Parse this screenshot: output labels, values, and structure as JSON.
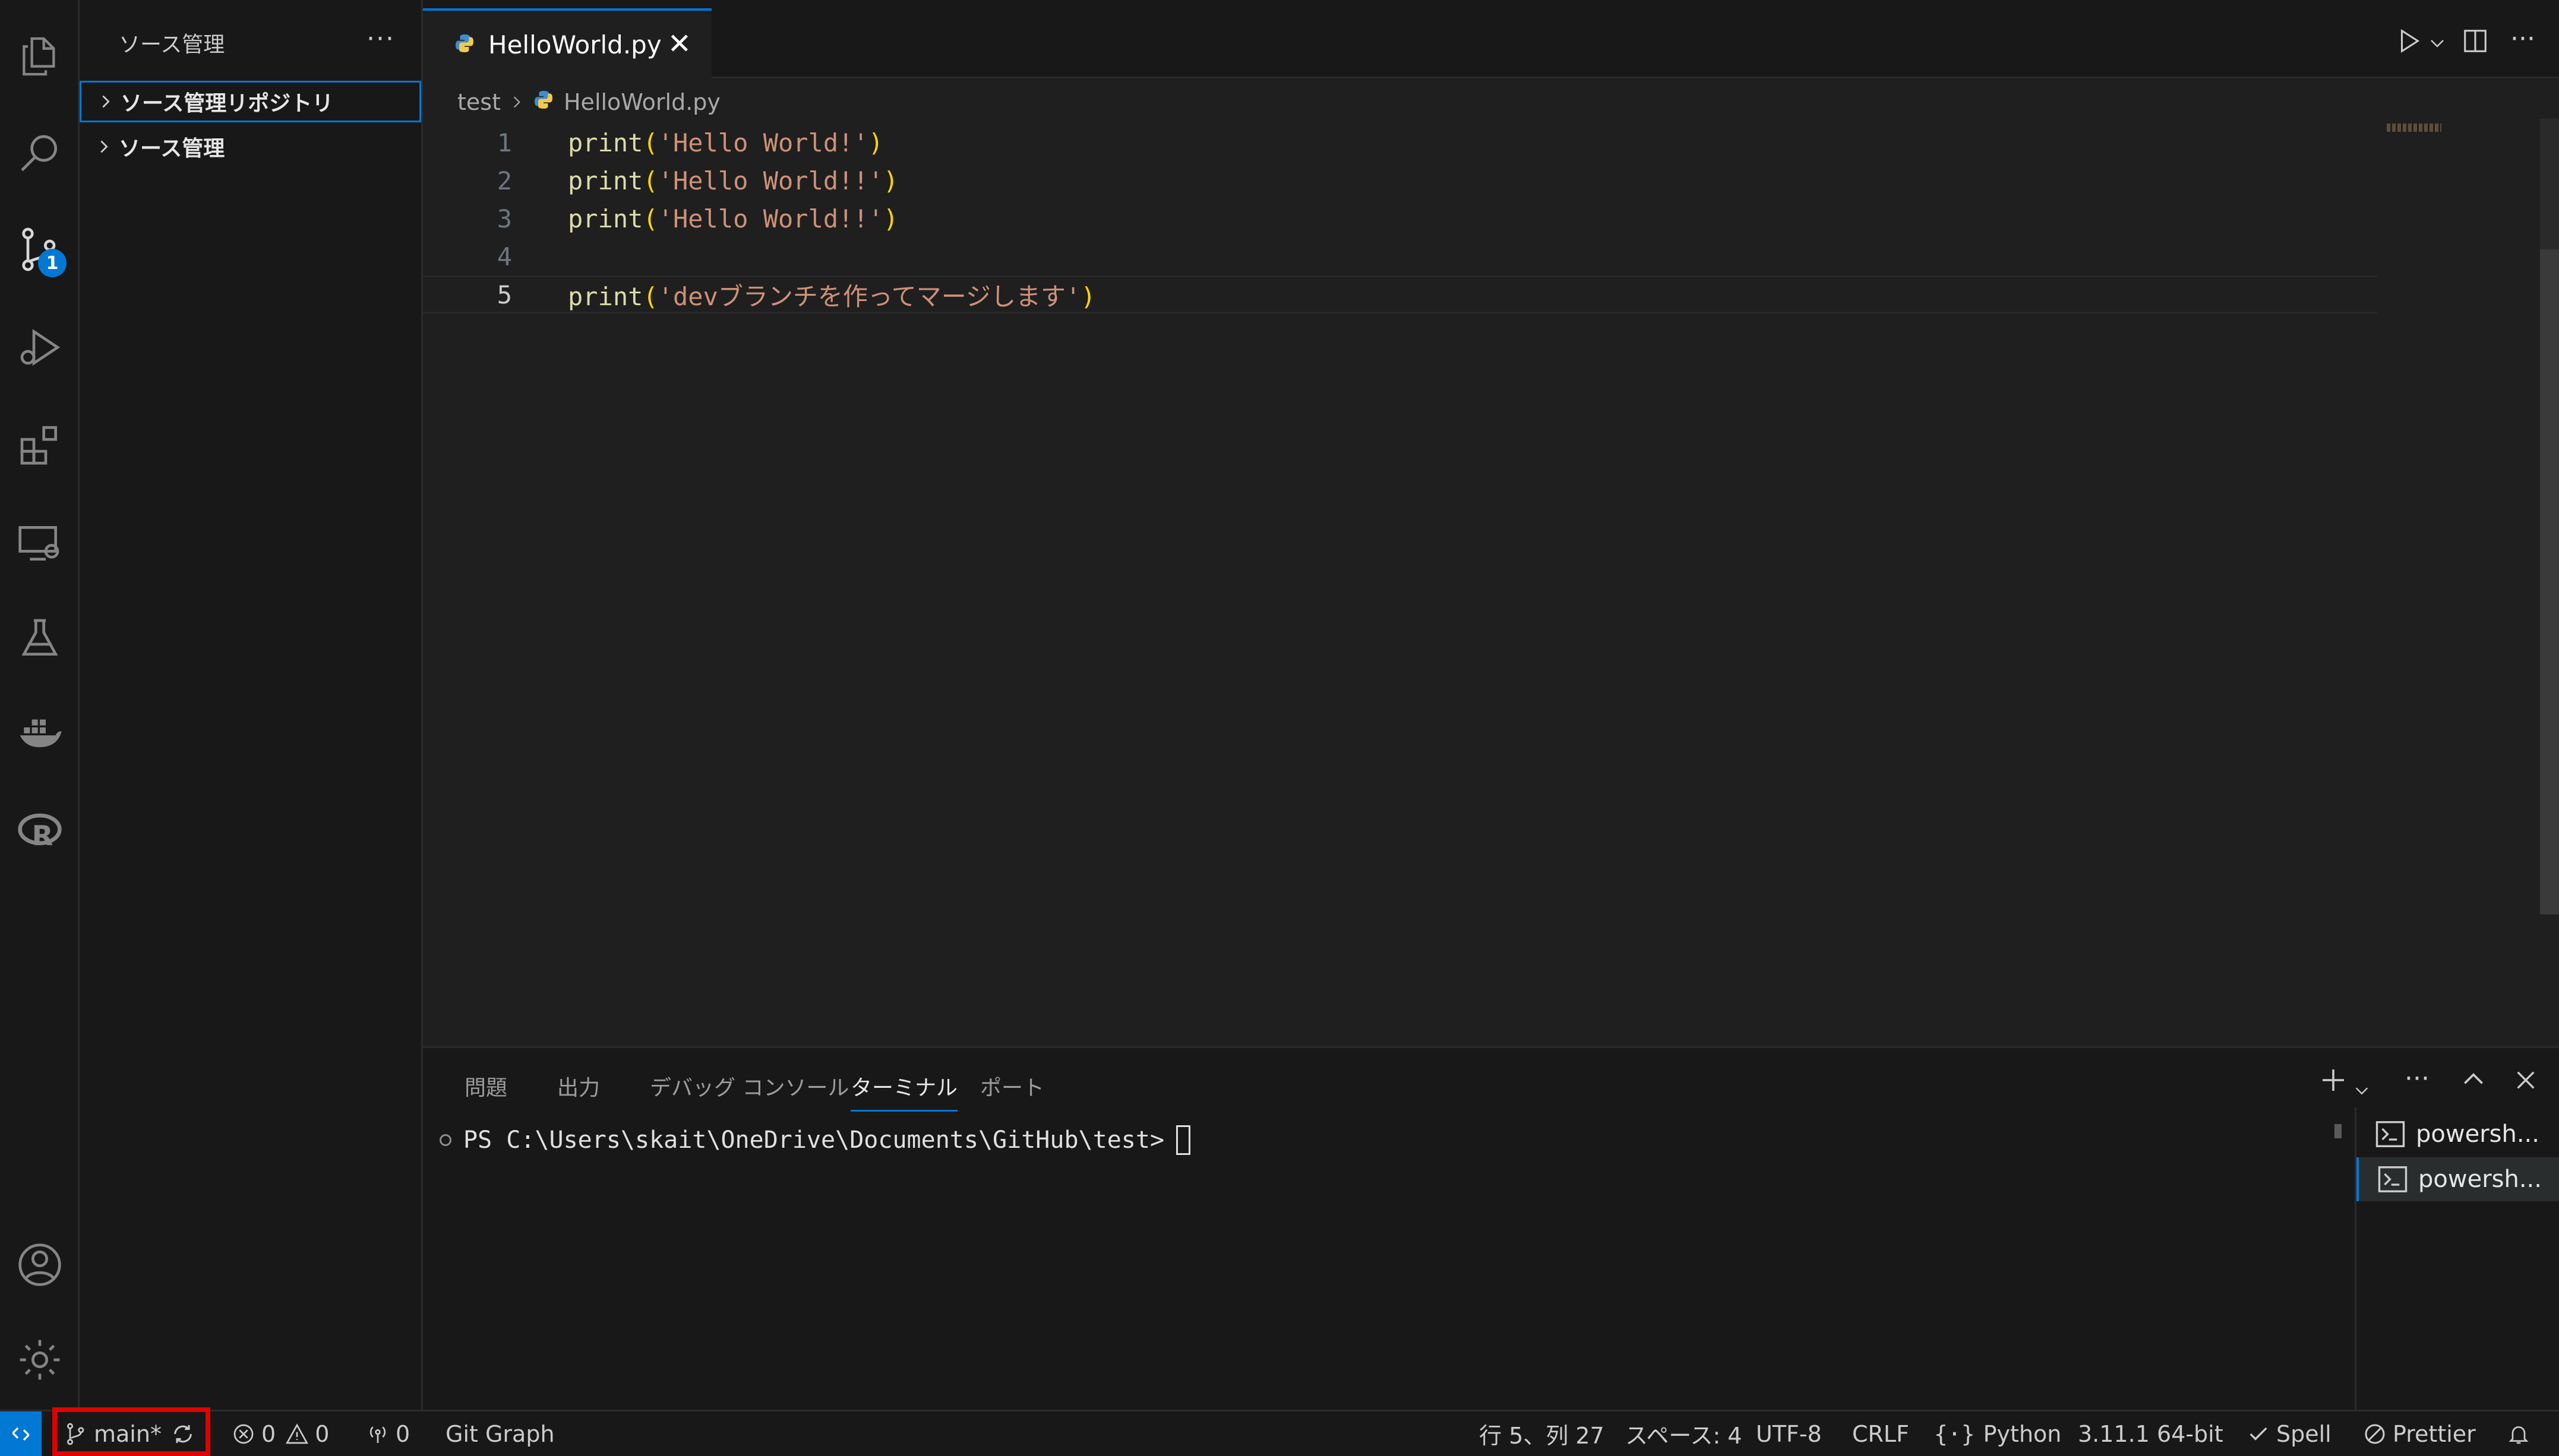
{
  "activity_bar": {
    "icons": [
      "explorer-icon",
      "search-icon",
      "source-control-icon",
      "run-debug-icon",
      "extensions-icon",
      "remote-explorer-icon",
      "testing-icon",
      "docker-icon",
      "r-icon",
      "account-icon",
      "settings-gear-icon"
    ],
    "source_control_badge": "1"
  },
  "sidebar": {
    "title": "ソース管理",
    "more": "···",
    "rows": [
      {
        "label": "ソース管理リポジトリ"
      },
      {
        "label": "ソース管理"
      }
    ]
  },
  "editor": {
    "tab": {
      "label": "HelloWorld.py",
      "close": "✕"
    },
    "breadcrumb": {
      "folder": "test",
      "file": "HelloWorld.py"
    },
    "lines": [
      {
        "num": "1",
        "fn": "print",
        "open": "(",
        "str": "'Hello World!'",
        "close": ")"
      },
      {
        "num": "2",
        "fn": "print",
        "open": "(",
        "str": "'Hello World!!'",
        "close": ")"
      },
      {
        "num": "3",
        "fn": "print",
        "open": "(",
        "str": "'Hello World!!'",
        "close": ")"
      },
      {
        "num": "4",
        "fn": "",
        "open": "",
        "str": "",
        "close": ""
      },
      {
        "num": "5",
        "fn": "print",
        "open": "(",
        "str": "'devブランチを作ってマージします'",
        "close": ")"
      }
    ]
  },
  "panel": {
    "tabs": [
      "問題",
      "出力",
      "デバッグ コンソール",
      "ターミナル",
      "ポート"
    ],
    "active_tab": "ターミナル",
    "terminal_prompt": "PS C:\\Users\\skait\\OneDrive\\Documents\\GitHub\\test>",
    "terminals": [
      "powersh...",
      "powersh..."
    ]
  },
  "status_bar": {
    "branch": "main*",
    "errors": "0",
    "warnings": "0",
    "ports": "0",
    "git_graph": "Git Graph",
    "position": "行 5、列 27",
    "indent": "スペース: 4",
    "encoding": "UTF-8",
    "eol": "CRLF",
    "language": "Python",
    "interpreter": "3.11.1 64-bit",
    "spell": "Spell",
    "prettier": "Prettier"
  },
  "colors": {
    "accent": "#0078d4",
    "highlight_box": "#e00000"
  }
}
